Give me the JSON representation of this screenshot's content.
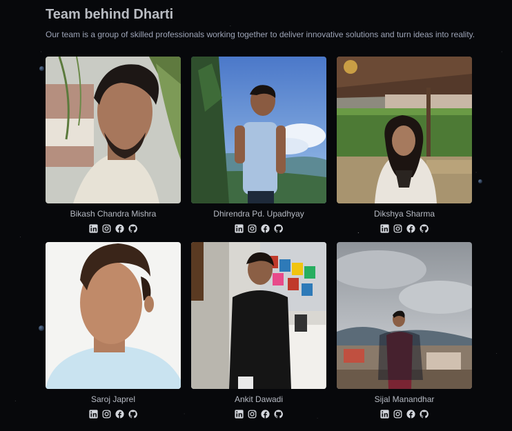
{
  "page": {
    "title": "Team behind Dharti",
    "description": "Our team is a group of skilled professionals working together to deliver innovative solutions and turn ideas into reality."
  },
  "team": [
    {
      "name": "Bikash Chandra Mishra"
    },
    {
      "name": "Dhirendra Pd. Upadhyay"
    },
    {
      "name": "Dikshya Sharma"
    },
    {
      "name": "Saroj Japrel"
    },
    {
      "name": "Ankit Dawadi"
    },
    {
      "name": "Sijal Manandhar"
    }
  ],
  "social_icons": [
    "linkedin-icon",
    "instagram-icon",
    "facebook-icon",
    "github-icon"
  ],
  "colors": {
    "background": "#07080b",
    "heading": "#b9bcc2",
    "text": "#9ea5b8",
    "icon": "#d3d6dc"
  }
}
